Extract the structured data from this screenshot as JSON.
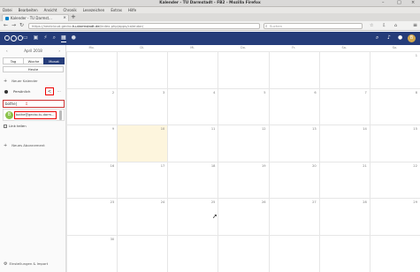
{
  "window": {
    "title": "Kalender - TU Darmstadt - FB2 - Mozilla Firefox",
    "min": "–",
    "max": "□",
    "close": "×"
  },
  "menu": [
    "Datei",
    "Bearbeiten",
    "Ansicht",
    "Chronik",
    "Lesezeichen",
    "Extras",
    "Hilfe"
  ],
  "tab": {
    "label": "Kalender - TU Darmst...",
    "close": "×",
    "new": "+"
  },
  "nav": {
    "back": "←",
    "forward": "→",
    "reload": "↻",
    "home": "⌂",
    "url_prefix": "https://nextcloud.gecko.",
    "url_domain": "tu-darmstadt.de",
    "url_path": "/index.php/apps/calendar/",
    "search_placeholder": "Suchen",
    "search_icon": "magnifier-icon",
    "icons": "☆ ⇩ ⌂",
    "menu_icon": "≡"
  },
  "appbar": {
    "icons": [
      "folder-icon",
      "image-icon",
      "lightning-icon",
      "search-icon",
      "calendar-icon",
      "contacts-icon"
    ],
    "glyphs": [
      "▭",
      "▣",
      "⚡",
      "⌕",
      "▦",
      "●"
    ],
    "right_icons": {
      "search": "⌕",
      "bell": "♪",
      "people": "●"
    },
    "avatar": "B"
  },
  "sidebar": {
    "month": "April 2018",
    "prev": "‹",
    "next": "›",
    "views": [
      "Tag",
      "Woche",
      "Monat"
    ],
    "selected_view": "Monat",
    "today": "Heute",
    "add_calendar": "Neuer Kalender",
    "calendar_name": "Persönlich",
    "share_glyph": "<",
    "more_glyph": "···",
    "share_input": "bothe|",
    "share_input_marker": "⇩",
    "suggest_avatar": "B",
    "suggest_email": "bothe@gecko.tu-darm...",
    "link_label": "Link teilen",
    "add_subscription": "Neues Abonnement",
    "settings_label": "Einstellungen & Import",
    "plus": "+",
    "gear": "⚙"
  },
  "calendar": {
    "weekdays": [
      "Mo.",
      "Di.",
      "Mi.",
      "Do.",
      "Fr.",
      "Sa.",
      "So."
    ],
    "weeks": [
      [
        "",
        "",
        "",
        "",
        "",
        "",
        "1"
      ],
      [
        "2",
        "3",
        "4",
        "5",
        "6",
        "7",
        "8"
      ],
      [
        "9",
        "10",
        "11",
        "12",
        "13",
        "14",
        "15"
      ],
      [
        "16",
        "17",
        "18",
        "19",
        "20",
        "21",
        "22"
      ],
      [
        "23",
        "24",
        "25",
        "26",
        "27",
        "28",
        "29"
      ],
      [
        "30",
        "",
        "",
        "",
        "",
        "",
        ""
      ]
    ],
    "today": "10"
  }
}
